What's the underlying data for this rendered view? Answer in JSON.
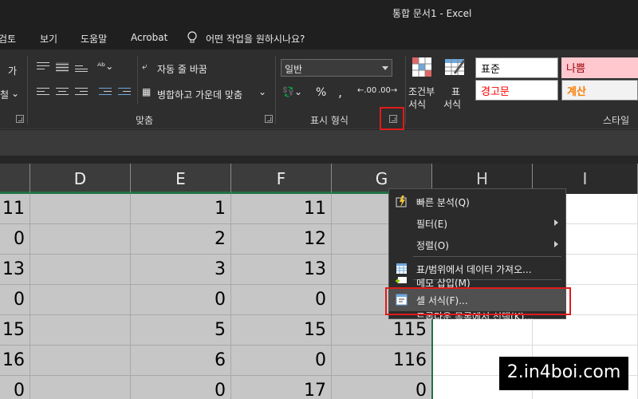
{
  "window": {
    "title": "통합 문서1  -  Excel"
  },
  "menu": {
    "items": [
      "검토",
      "보기",
      "도움말",
      "Acrobat"
    ],
    "tell_me": "어떤 작업을 원하시나요?"
  },
  "ribbon": {
    "groups": [
      "맞춤",
      "표시 형식",
      "스타일"
    ],
    "wrap_text": "자동 줄 바꿈",
    "merge_center": "병합하고 가운데 맞춤",
    "font_fragment_1": "가",
    "font_fragment_2": "철",
    "number_format": "일반",
    "percent": "%",
    "comma": ",",
    "conditional_formatting": [
      "조건부",
      "서식"
    ],
    "format_as_table": [
      "표",
      "서식"
    ],
    "styles": {
      "normal": "표준",
      "bad": "나쁨",
      "warning": "경고문",
      "calculation": "계산"
    }
  },
  "sheet": {
    "columns": [
      "D",
      "E",
      "F",
      "G",
      "H",
      "I"
    ],
    "rows": [
      {
        "c": "11",
        "d": "",
        "e": "1",
        "f": "11",
        "g": ""
      },
      {
        "c": "0",
        "d": "",
        "e": "2",
        "f": "12",
        "g": ""
      },
      {
        "c": "13",
        "d": "",
        "e": "3",
        "f": "13",
        "g": ""
      },
      {
        "c": "0",
        "d": "",
        "e": "0",
        "f": "0",
        "g": ""
      },
      {
        "c": "15",
        "d": "",
        "e": "5",
        "f": "15",
        "g": "115"
      },
      {
        "c": "16",
        "d": "",
        "e": "6",
        "f": "0",
        "g": "116"
      },
      {
        "c": "0",
        "d": "",
        "e": "0",
        "f": "17",
        "g": "0"
      }
    ]
  },
  "context_menu": {
    "items": [
      {
        "label": "빠른 분석(Q)",
        "icon": "quick-analysis-icon",
        "submenu": false
      },
      {
        "label": "필터(E)",
        "icon": "",
        "submenu": true
      },
      {
        "label": "정렬(O)",
        "icon": "",
        "submenu": true
      },
      {
        "label": "표/범위에서 데이터 가져오...",
        "icon": "table-icon",
        "submenu": false
      },
      {
        "label": "메모 삽입(M)",
        "icon": "comment-icon",
        "submenu": false
      },
      {
        "label": "셀 서식(F)...",
        "icon": "format-cells-icon",
        "submenu": false,
        "highlighted": true
      },
      {
        "label": "드롭다운 목록에서 선택(K)...",
        "icon": "",
        "submenu": false
      }
    ]
  },
  "watermark": "2.in4boi.com",
  "colors": {
    "highlight": "#e01b1b",
    "selection": "#207245",
    "bad_bg": "#ffc7ce",
    "bad_text": "#9c0006",
    "calc_text": "#fa7d00",
    "warning_text": "#ff0000"
  }
}
